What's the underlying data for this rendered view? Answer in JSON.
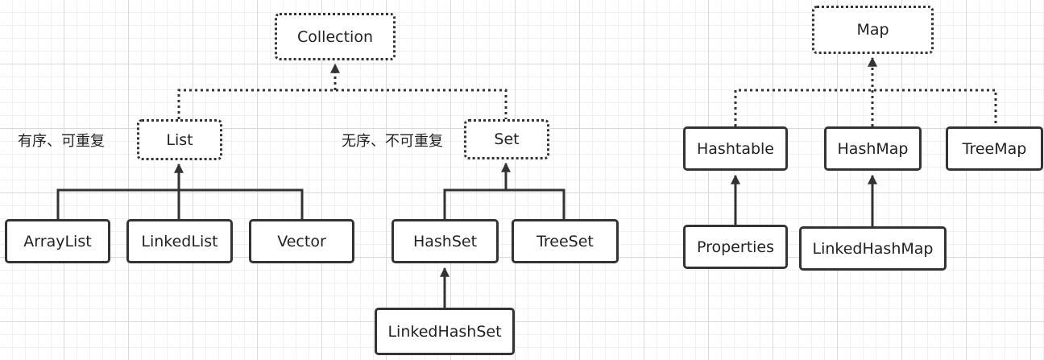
{
  "diagram": {
    "nodes": {
      "collection": "Collection",
      "list": "List",
      "set": "Set",
      "arraylist": "ArrayList",
      "linkedlist": "LinkedList",
      "vector": "Vector",
      "hashset": "HashSet",
      "treeset": "TreeSet",
      "linkedhashset": "LinkedHashSet",
      "map": "Map",
      "hashtable": "Hashtable",
      "hashmap": "HashMap",
      "treemap": "TreeMap",
      "properties": "Properties",
      "linkedhashmap": "LinkedHashMap"
    },
    "notes": {
      "list_note": "有序、可重复",
      "set_note": "无序、不可重复"
    },
    "colors": {
      "line": "#333333",
      "box_fill": "#ffffff",
      "grid": "#d9d9d9"
    }
  }
}
